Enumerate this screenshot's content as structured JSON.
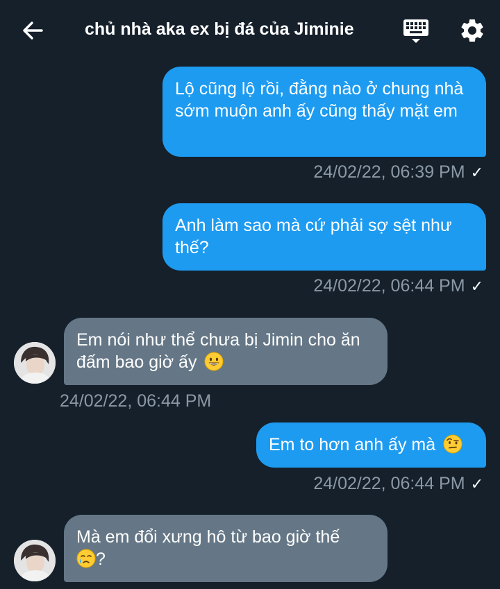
{
  "header": {
    "title": "chủ nhà aka ex bị đá của Jiminie",
    "back_icon": "arrow-left-icon",
    "keyboard_icon": "keyboard-icon",
    "settings_icon": "gear-icon"
  },
  "colors": {
    "background": "#15202b",
    "outgoing_bubble": "#1d9bf0",
    "incoming_bubble": "#657786",
    "timestamp": "#8b98a5"
  },
  "messages": [
    {
      "direction": "outgoing",
      "text": "Lộ cũng lộ rồi, đằng nào ở chung nhà sớm muộn anh ấy cũng thấy mặt em",
      "timestamp": "24/02/22, 06:39 PM",
      "read_mark": "✓"
    },
    {
      "direction": "outgoing",
      "text": "Anh làm sao mà cứ phải sợ sệt như thế?",
      "timestamp": "24/02/22, 06:44 PM",
      "read_mark": "✓"
    },
    {
      "direction": "incoming",
      "text": "Em nói như thể chưa bị Jimin cho ăn đấm bao giờ ấy",
      "emoji": "grinning-face-emoji",
      "timestamp": "24/02/22, 06:44 PM"
    },
    {
      "direction": "outgoing",
      "text": "Em to hơn anh ấy mà",
      "emoji": "raised-eyebrow-face-emoji",
      "timestamp": "24/02/22, 06:44 PM",
      "read_mark": "✓"
    },
    {
      "direction": "incoming",
      "text": "Mà em đổi xưng hô từ bao giờ thế",
      "emoji": "crying-face-emoji",
      "text_after_emoji": "?"
    }
  ]
}
